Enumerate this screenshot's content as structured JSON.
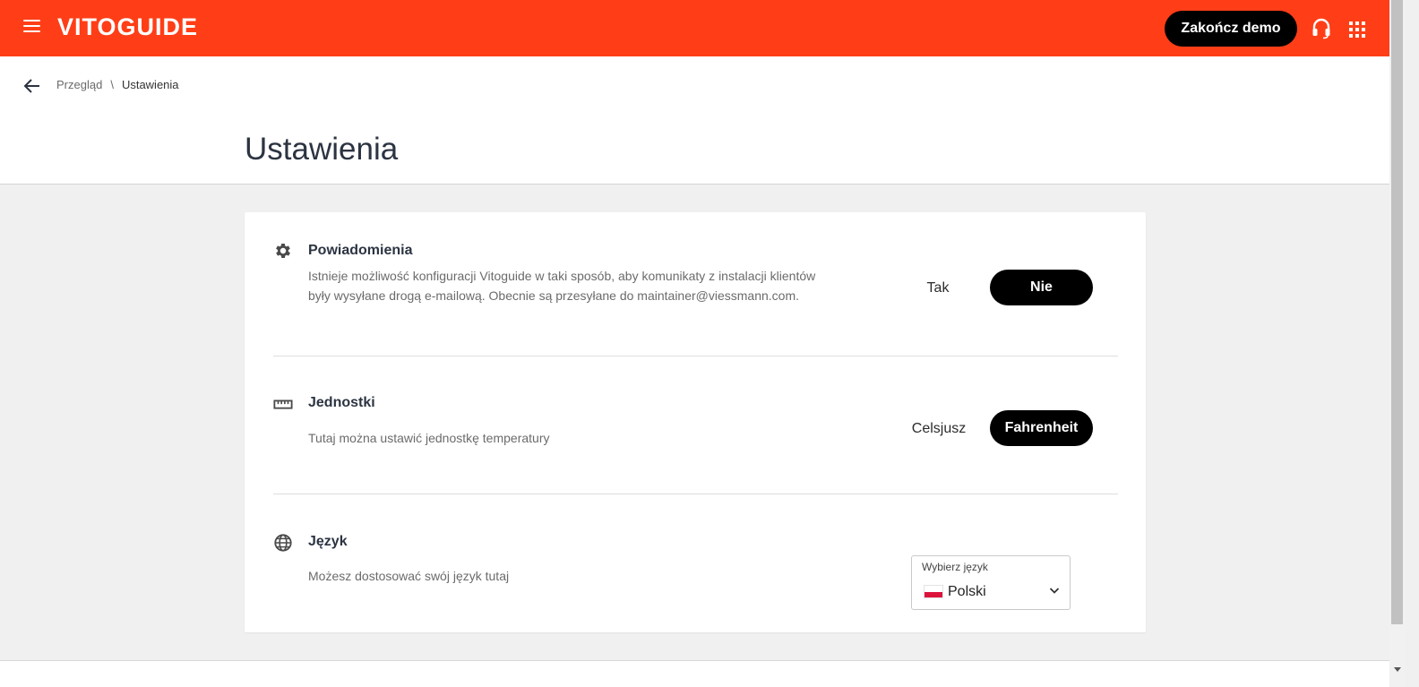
{
  "header": {
    "logo": "VITOGUIDE",
    "demo_button": "Zakończ demo",
    "icons": [
      "menu-icon",
      "headset-icon",
      "apps-grid-icon"
    ],
    "brand_color": "#ff3e17"
  },
  "breadcrumb": {
    "items": [
      "Przegląd",
      "Ustawienia"
    ],
    "separator": "\\"
  },
  "page": {
    "title": "Ustawienia"
  },
  "settings": {
    "notifications": {
      "icon": "gear-icon",
      "title": "Powiadomienia",
      "description": "Istnieje możliwość konfiguracji Vitoguide w taki sposób, aby komunikaty z instalacji klientów były wysyłane drogą e-mailową. Obecnie są przesyłane do maintainer@viessmann.com.",
      "option_yes": "Tak",
      "option_no": "Nie",
      "selected": "Nie"
    },
    "units": {
      "icon": "ruler-icon",
      "title": "Jednostki",
      "description": "Tutaj można ustawić jednostkę temperatury",
      "option_celsius": "Celsjusz",
      "option_fahrenheit": "Fahrenheit",
      "selected": "Fahrenheit"
    },
    "language": {
      "icon": "globe-icon",
      "title": "Język",
      "description": "Możesz dostosować swój język tutaj",
      "select_label": "Wybierz język",
      "selected": "Polski",
      "flag_icon": "poland-flag-icon"
    }
  }
}
